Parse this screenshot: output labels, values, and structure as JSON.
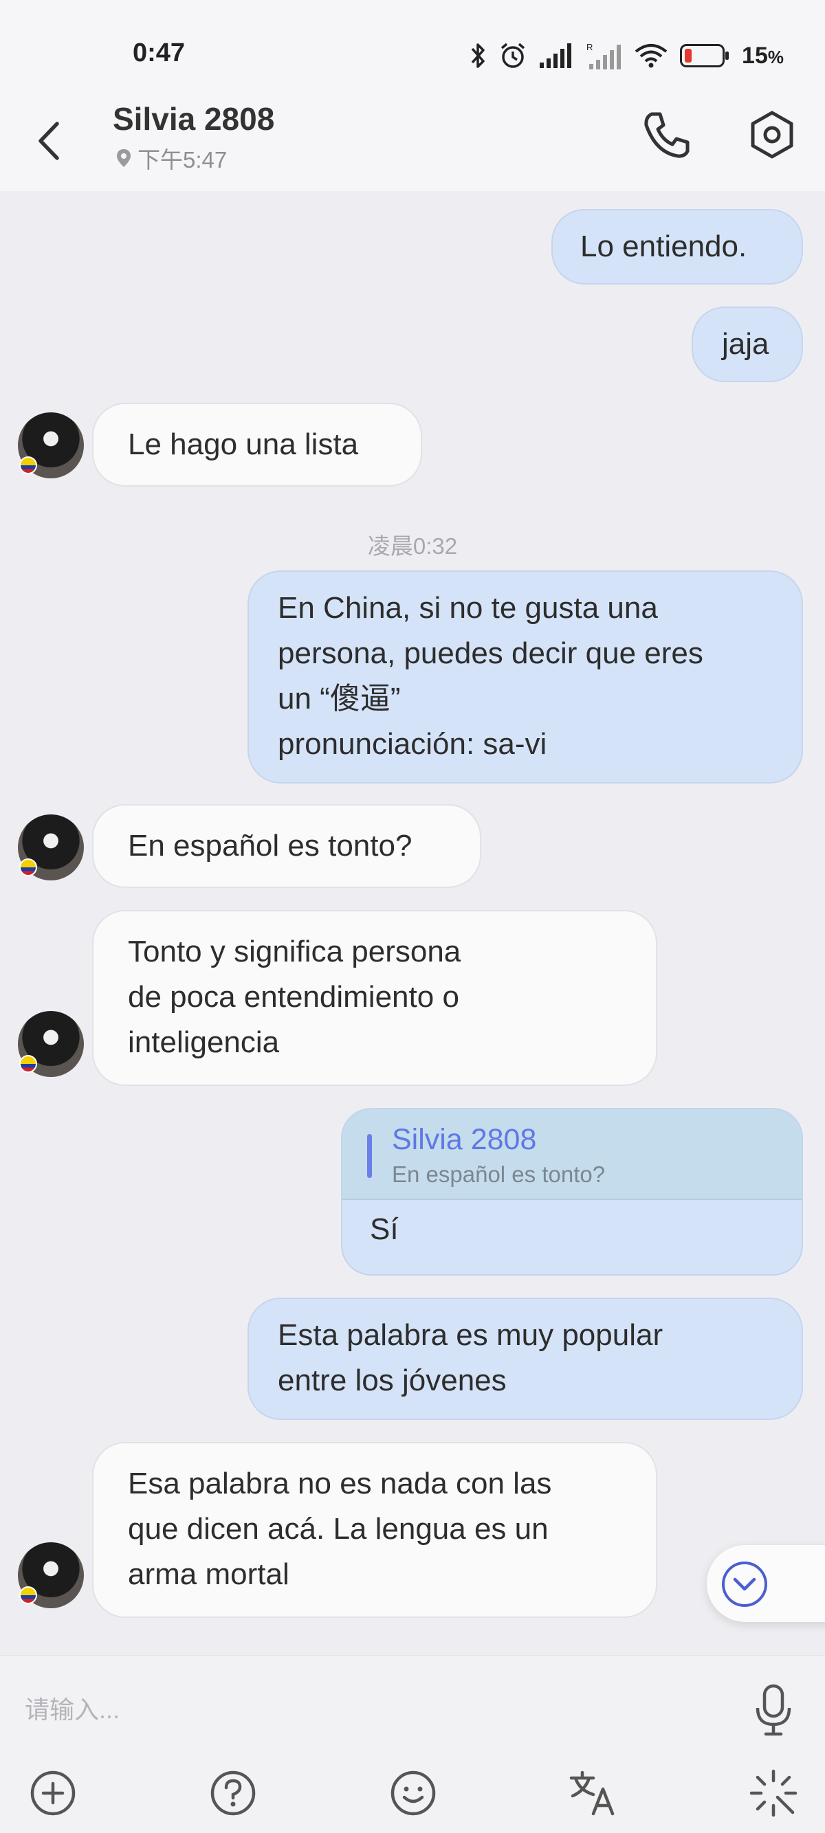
{
  "status_bar": {
    "time": "0:47",
    "battery_percent": "15",
    "battery_unit": "%",
    "icons": [
      "bluetooth-icon",
      "alarm-icon",
      "signal-icon",
      "signal-roaming-icon",
      "wifi-icon",
      "battery-low-icon"
    ]
  },
  "header": {
    "contact_name": "Silvia 2808",
    "local_time": "下午5:47",
    "icons": [
      "back-icon",
      "location-pin-icon",
      "phone-icon",
      "settings-icon"
    ]
  },
  "messages": [
    {
      "direction": "out",
      "text": "Lo entiendo."
    },
    {
      "direction": "out",
      "text": "jaja"
    },
    {
      "direction": "in",
      "text": "Le hago una lista"
    },
    {
      "type": "timestamp",
      "text": "凌晨0:32"
    },
    {
      "direction": "out",
      "text": "En China, si no te gusta una\npersona, puedes decir que eres\nun “傻逼”\npronunciación: sa-vi"
    },
    {
      "direction": "in",
      "text": "En español es tonto?"
    },
    {
      "direction": "in",
      "text": "Tonto  y significa persona\nde poca entendimiento o\ninteligencia"
    },
    {
      "direction": "out",
      "reply_to": {
        "name": "Silvia 2808",
        "text": "En español es tonto?"
      },
      "text": "Sí"
    },
    {
      "direction": "out",
      "text": "Esta palabra es muy popular\nentre los jóvenes"
    },
    {
      "direction": "in",
      "text": "Esa palabra no es nada con las\nque dicen acá. La lengua es un\narma mortal"
    }
  ],
  "input": {
    "placeholder": "请输入..."
  },
  "toolbar": [
    "add-icon",
    "help-icon",
    "emoji-icon",
    "translate-icon",
    "magic-icon"
  ],
  "colors": {
    "outgoing_bubble": "#d5e3f8",
    "incoming_bubble": "#fafafa",
    "accent": "#5f78e4",
    "background": "#eeeef2"
  }
}
